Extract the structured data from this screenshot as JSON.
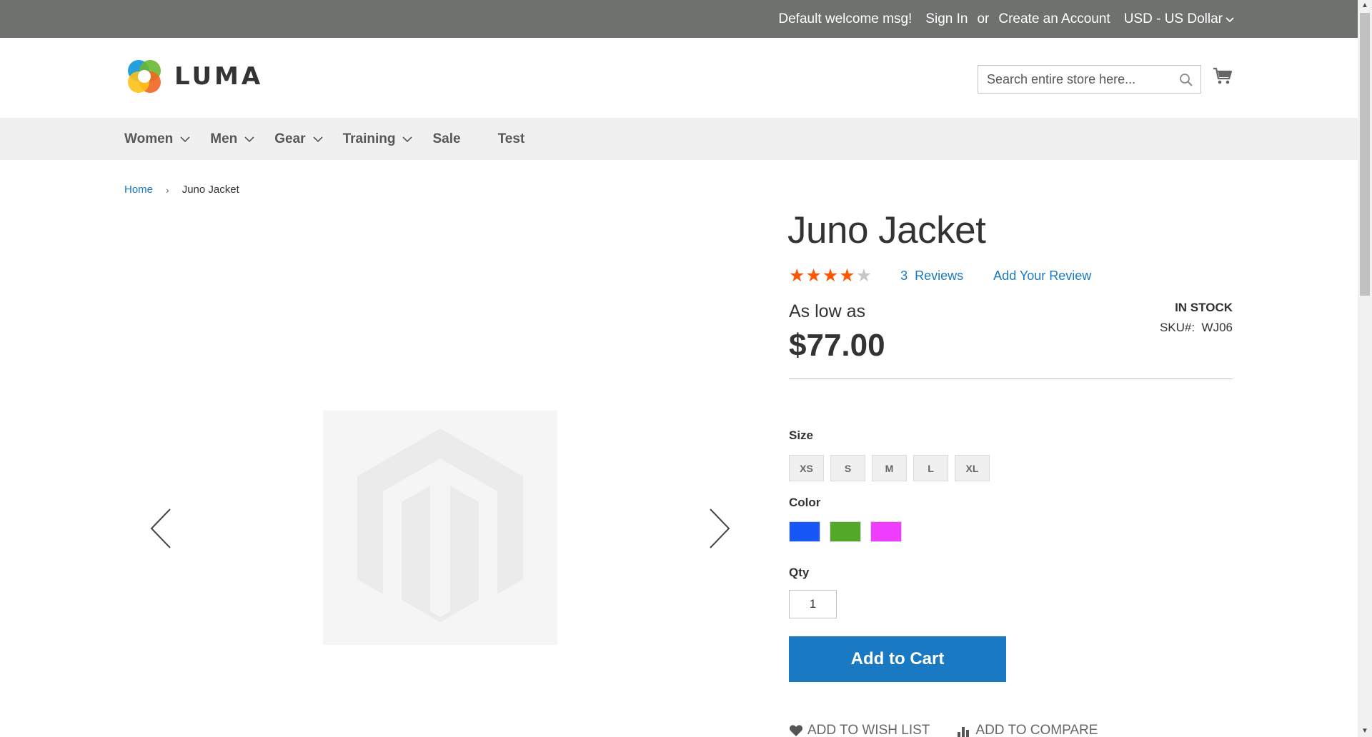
{
  "top_bar": {
    "welcome": "Default welcome msg!",
    "sign_in": "Sign In",
    "or": "or",
    "create_account": "Create an Account",
    "currency": "USD - US Dollar"
  },
  "header": {
    "logo_text": "LUMA",
    "search_placeholder": "Search entire store here..."
  },
  "nav": {
    "items": [
      {
        "label": "Women",
        "has_dropdown": true
      },
      {
        "label": "Men",
        "has_dropdown": true
      },
      {
        "label": "Gear",
        "has_dropdown": true
      },
      {
        "label": "Training",
        "has_dropdown": true
      },
      {
        "label": "Sale",
        "has_dropdown": false
      },
      {
        "label": "Test",
        "has_dropdown": false
      }
    ]
  },
  "breadcrumb": {
    "home": "Home",
    "separator": "›",
    "current": "Juno Jacket"
  },
  "product": {
    "title": "Juno Jacket",
    "rating_stars": 4,
    "rating_max": 5,
    "reviews_count": "3",
    "reviews_label": "Reviews",
    "add_review": "Add Your Review",
    "price_label": "As low as",
    "price": "$77.00",
    "stock_status": "IN STOCK",
    "sku_label": "SKU#:",
    "sku": "WJ06",
    "size_label": "Size",
    "sizes": [
      "XS",
      "S",
      "M",
      "L",
      "XL"
    ],
    "color_label": "Color",
    "colors": [
      "#1857f7",
      "#53a828",
      "#ef3dff"
    ],
    "qty_label": "Qty",
    "qty_value": "1",
    "add_to_cart": "Add to Cart",
    "wishlist": "Add to Wish List",
    "compare": "Add to Compare"
  },
  "colors": {
    "top_bar_bg": "#6e716e",
    "nav_bg": "#f0f0f0",
    "link": "#1979c3",
    "primary_button": "#1979c3",
    "star": "#ff5501"
  },
  "icons": [
    "chevron-down-icon",
    "search-icon",
    "cart-icon",
    "chevron-left-icon",
    "chevron-right-icon",
    "heart-icon",
    "bar-chart-icon",
    "luma-logo"
  ]
}
